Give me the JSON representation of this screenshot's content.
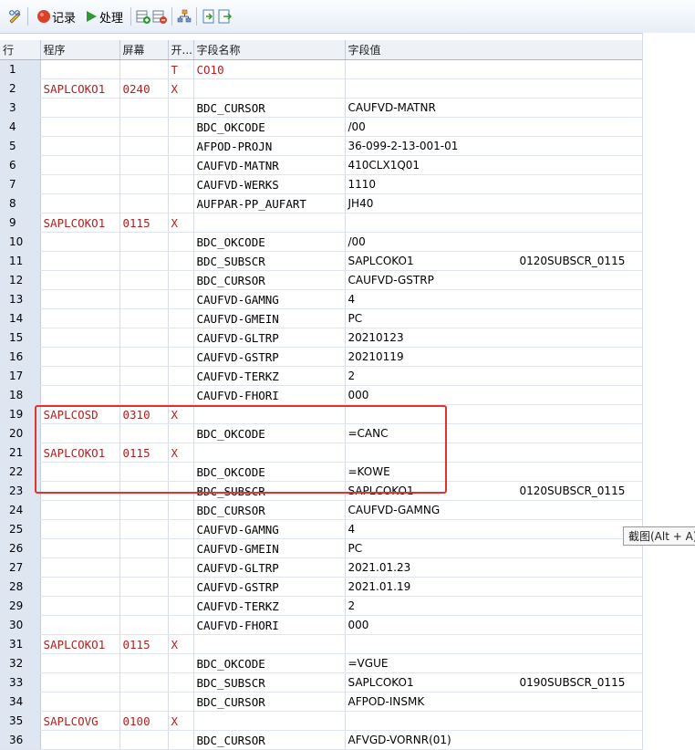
{
  "toolbar": {
    "record_label": "记录",
    "process_label": "处理"
  },
  "columns": [
    "行",
    "程序",
    "屏幕",
    "开...",
    "字段名称",
    "字段值"
  ],
  "rows": [
    {
      "n": "1",
      "prog": "",
      "scr": "",
      "st": "T",
      "fn": "CO10",
      "fv": "",
      "x": "",
      "fn_red": true
    },
    {
      "n": "2",
      "prog": "SAPLCOKO1",
      "scr": "0240",
      "st": "X",
      "fn": "",
      "fv": "",
      "x": ""
    },
    {
      "n": "3",
      "prog": "",
      "scr": "",
      "st": "",
      "fn": "BDC_CURSOR",
      "fv": "CAUFVD-MATNR",
      "x": ""
    },
    {
      "n": "4",
      "prog": "",
      "scr": "",
      "st": "",
      "fn": "BDC_OKCODE",
      "fv": "/00",
      "x": ""
    },
    {
      "n": "5",
      "prog": "",
      "scr": "",
      "st": "",
      "fn": "AFPOD-PROJN",
      "fv": "36-099-2-13-001-01",
      "x": ""
    },
    {
      "n": "6",
      "prog": "",
      "scr": "",
      "st": "",
      "fn": "CAUFVD-MATNR",
      "fv": "410CLX1Q01",
      "x": ""
    },
    {
      "n": "7",
      "prog": "",
      "scr": "",
      "st": "",
      "fn": "CAUFVD-WERKS",
      "fv": "1110",
      "x": ""
    },
    {
      "n": "8",
      "prog": "",
      "scr": "",
      "st": "",
      "fn": "AUFPAR-PP_AUFART",
      "fv": "JH40",
      "x": ""
    },
    {
      "n": "9",
      "prog": "SAPLCOKO1",
      "scr": "0115",
      "st": "X",
      "fn": "",
      "fv": "",
      "x": ""
    },
    {
      "n": "10",
      "prog": "",
      "scr": "",
      "st": "",
      "fn": "BDC_OKCODE",
      "fv": "/00",
      "x": ""
    },
    {
      "n": "11",
      "prog": "",
      "scr": "",
      "st": "",
      "fn": "BDC_SUBSCR",
      "fv": "SAPLCOKO1",
      "x": "0120SUBSCR_0115"
    },
    {
      "n": "12",
      "prog": "",
      "scr": "",
      "st": "",
      "fn": "BDC_CURSOR",
      "fv": "CAUFVD-GSTRP",
      "x": ""
    },
    {
      "n": "13",
      "prog": "",
      "scr": "",
      "st": "",
      "fn": "CAUFVD-GAMNG",
      "fv": "4",
      "x": ""
    },
    {
      "n": "14",
      "prog": "",
      "scr": "",
      "st": "",
      "fn": "CAUFVD-GMEIN",
      "fv": "PC",
      "x": ""
    },
    {
      "n": "15",
      "prog": "",
      "scr": "",
      "st": "",
      "fn": "CAUFVD-GLTRP",
      "fv": "20210123",
      "x": ""
    },
    {
      "n": "16",
      "prog": "",
      "scr": "",
      "st": "",
      "fn": "CAUFVD-GSTRP",
      "fv": "20210119",
      "x": ""
    },
    {
      "n": "17",
      "prog": "",
      "scr": "",
      "st": "",
      "fn": "CAUFVD-TERKZ",
      "fv": "2",
      "x": ""
    },
    {
      "n": "18",
      "prog": "",
      "scr": "",
      "st": "",
      "fn": "CAUFVD-FHORI",
      "fv": "000",
      "x": ""
    },
    {
      "n": "19",
      "prog": "SAPLCOSD",
      "scr": "0310",
      "st": "X",
      "fn": "",
      "fv": "",
      "x": ""
    },
    {
      "n": "20",
      "prog": "",
      "scr": "",
      "st": "",
      "fn": "BDC_OKCODE",
      "fv": "=CANC",
      "x": ""
    },
    {
      "n": "21",
      "prog": "SAPLCOKO1",
      "scr": "0115",
      "st": "X",
      "fn": "",
      "fv": "",
      "x": ""
    },
    {
      "n": "22",
      "prog": "",
      "scr": "",
      "st": "",
      "fn": "BDC_OKCODE",
      "fv": "=KOWE",
      "x": ""
    },
    {
      "n": "23",
      "prog": "",
      "scr": "",
      "st": "",
      "fn": "BDC_SUBSCR",
      "fv": "SAPLCOKO1",
      "x": "0120SUBSCR_0115"
    },
    {
      "n": "24",
      "prog": "",
      "scr": "",
      "st": "",
      "fn": "BDC_CURSOR",
      "fv": "CAUFVD-GAMNG",
      "x": ""
    },
    {
      "n": "25",
      "prog": "",
      "scr": "",
      "st": "",
      "fn": "CAUFVD-GAMNG",
      "fv": "4",
      "x": ""
    },
    {
      "n": "26",
      "prog": "",
      "scr": "",
      "st": "",
      "fn": "CAUFVD-GMEIN",
      "fv": "PC",
      "x": ""
    },
    {
      "n": "27",
      "prog": "",
      "scr": "",
      "st": "",
      "fn": "CAUFVD-GLTRP",
      "fv": "2021.01.23",
      "x": ""
    },
    {
      "n": "28",
      "prog": "",
      "scr": "",
      "st": "",
      "fn": "CAUFVD-GSTRP",
      "fv": "2021.01.19",
      "x": ""
    },
    {
      "n": "29",
      "prog": "",
      "scr": "",
      "st": "",
      "fn": "CAUFVD-TERKZ",
      "fv": "2",
      "x": ""
    },
    {
      "n": "30",
      "prog": "",
      "scr": "",
      "st": "",
      "fn": "CAUFVD-FHORI",
      "fv": "000",
      "x": ""
    },
    {
      "n": "31",
      "prog": "SAPLCOKO1",
      "scr": "0115",
      "st": "X",
      "fn": "",
      "fv": "",
      "x": ""
    },
    {
      "n": "32",
      "prog": "",
      "scr": "",
      "st": "",
      "fn": "BDC_OKCODE",
      "fv": "=VGUE",
      "x": ""
    },
    {
      "n": "33",
      "prog": "",
      "scr": "",
      "st": "",
      "fn": "BDC_SUBSCR",
      "fv": "SAPLCOKO1",
      "x": "0190SUBSCR_0115"
    },
    {
      "n": "34",
      "prog": "",
      "scr": "",
      "st": "",
      "fn": "BDC_CURSOR",
      "fv": "AFPOD-INSMK",
      "x": ""
    },
    {
      "n": "35",
      "prog": "SAPLCOVG",
      "scr": "0100",
      "st": "X",
      "fn": "",
      "fv": "",
      "x": ""
    },
    {
      "n": "36",
      "prog": "",
      "scr": "",
      "st": "",
      "fn": "BDC_CURSOR",
      "fv": "AFVGD-VORNR(01)",
      "x": ""
    }
  ],
  "tooltip": "截图(Alt + A)",
  "colors": {
    "red_text": "#b21f1f",
    "highlight": "#e0332f",
    "rownum_bg": "#dee6f1"
  }
}
